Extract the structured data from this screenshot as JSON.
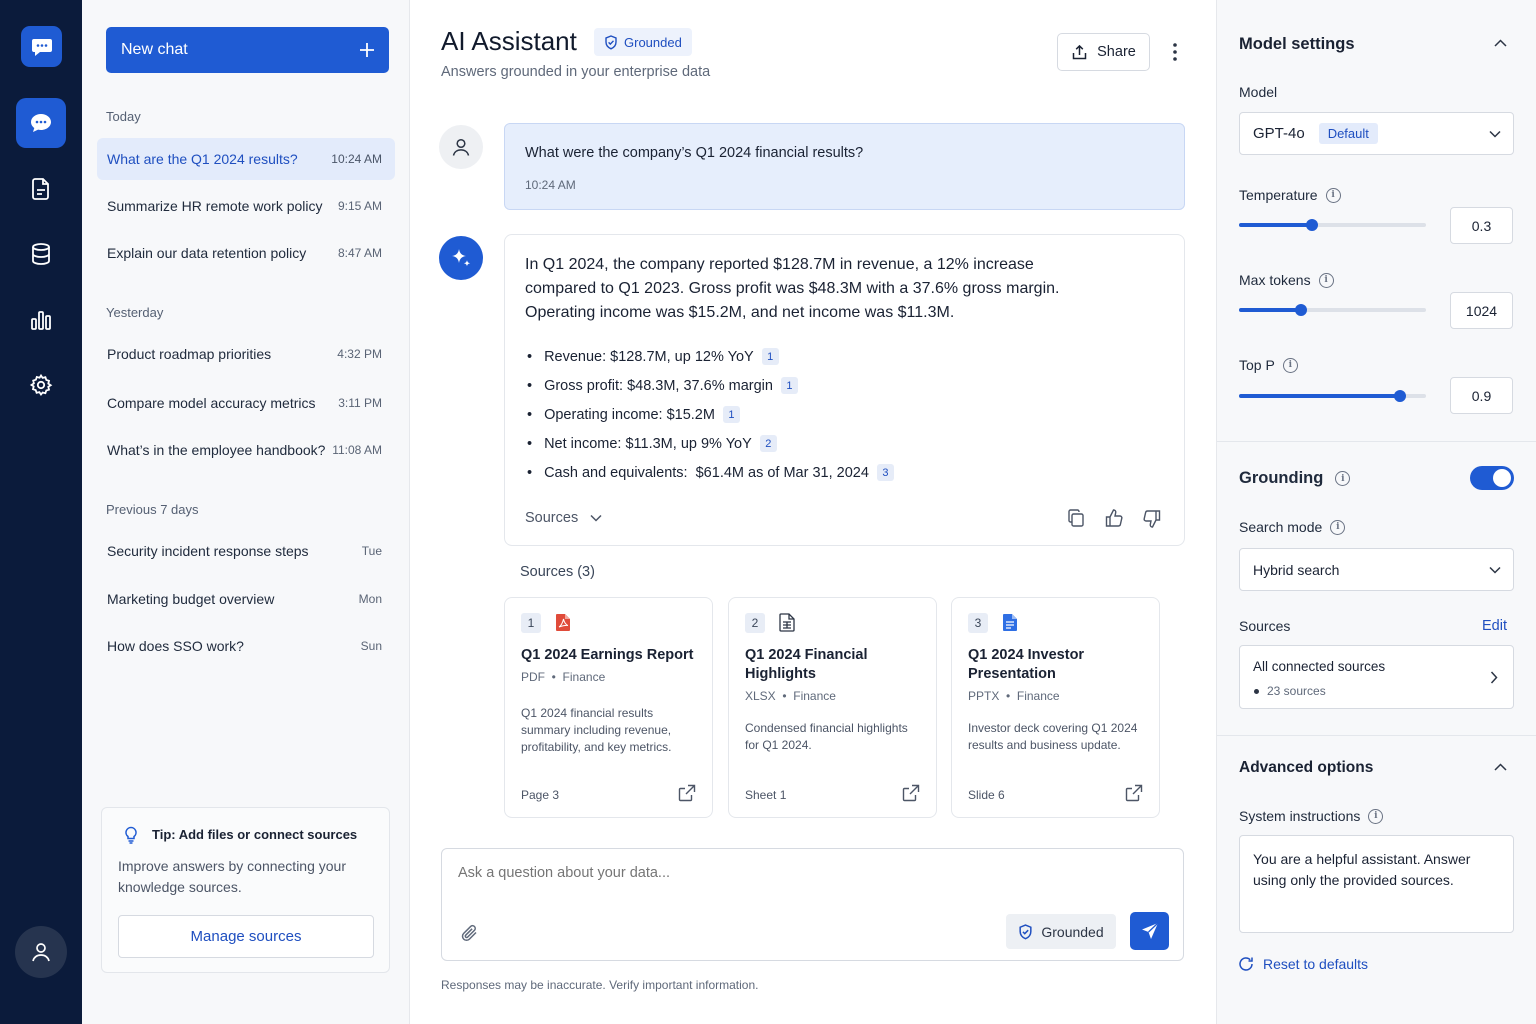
{
  "colors": {
    "accent": "#1f5bd3",
    "rail": "#0b1b3b"
  },
  "rail": {
    "icons": [
      "chat-bubble-icon",
      "chat-icon",
      "document-icon",
      "database-icon",
      "bar-chart-icon",
      "gear-icon",
      "user-icon"
    ]
  },
  "history": {
    "new_chat_label": "New chat",
    "groups": [
      {
        "label": "Today",
        "items": [
          {
            "title": "What are the Q1 2024 results?",
            "time": "10:24 AM"
          },
          {
            "title": "Summarize HR remote work policy",
            "time": "9:15 AM"
          },
          {
            "title": "Explain our data retention policy",
            "time": "8:47 AM"
          }
        ]
      },
      {
        "label": "Yesterday",
        "items": [
          {
            "title": "Product roadmap priorities",
            "time": "4:32 PM"
          },
          {
            "title": "Compare model accuracy metrics",
            "time": "3:11 PM"
          },
          {
            "title": "What’s in the employee handbook?",
            "time": "11:08 AM"
          }
        ]
      },
      {
        "label": "Previous 7 days",
        "items": [
          {
            "title": "Security incident response steps",
            "time": "Tue"
          },
          {
            "title": "Marketing budget overview",
            "time": "Mon"
          },
          {
            "title": "How does SSO work?",
            "time": "Sun"
          }
        ]
      }
    ],
    "tip": {
      "title": "Tip: Add files or connect sources",
      "body": "Improve answers by connecting your knowledge sources.",
      "button": "Manage sources"
    }
  },
  "header": {
    "title": "AI Assistant",
    "badge": "Grounded",
    "subtitle": "Answers grounded in your enterprise data",
    "share_label": "Share"
  },
  "user_message": {
    "text": "What were the company’s Q1 2024 financial results?",
    "time": "10:24 AM"
  },
  "assistant_message": {
    "paragraph": "In Q1 2024, the company reported $128.7M in revenue, a 12% increase compared to Q1 2023. Gross profit was $48.3M with a 37.6% gross margin. Operating income was $15.2M, and net income was $11.3M.",
    "bullets": [
      {
        "text": "Revenue: $128.7M, up 12% YoY",
        "cite": "1"
      },
      {
        "text": "Gross profit: $48.3M, 37.6% margin",
        "cite": "1"
      },
      {
        "text": "Operating income: $15.2M",
        "cite": "1"
      },
      {
        "text": "Net income: $11.3M, up 9% YoY",
        "cite": "2"
      },
      {
        "text": "Cash and equivalents:  $61.4M as of Mar 31, 2024",
        "cite": "3"
      }
    ],
    "sources_toggle": "Sources"
  },
  "sources": {
    "heading": "Sources (3)",
    "cards": [
      {
        "num": "1",
        "icon": "pdf-icon",
        "title": "Q1 2024 Earnings Report",
        "type": "PDF",
        "category": "Finance",
        "desc": "Q1 2024 financial results summary including revenue, profitability, and key metrics.",
        "loc": "Page 3"
      },
      {
        "num": "2",
        "icon": "spreadsheet-icon",
        "title": "Q1 2024 Financial Highlights",
        "type": "XLSX",
        "category": "Finance",
        "desc": "Condensed financial highlights for Q1 2024.",
        "loc": "Sheet 1"
      },
      {
        "num": "3",
        "icon": "presentation-icon",
        "title": "Q1 2024 Investor Presentation",
        "type": "PPTX",
        "category": "Finance",
        "desc": "Investor deck covering Q1 2024 results and business update.",
        "loc": "Slide 6"
      }
    ]
  },
  "composer": {
    "placeholder": "Ask a question about your data...",
    "grounded_label": "Grounded",
    "disclaimer": "Responses may be inaccurate. Verify important information."
  },
  "settings": {
    "title": "Model settings",
    "model_label": "Model",
    "model_value": "GPT-4o",
    "model_badge": "Default",
    "temperature": {
      "label": "Temperature",
      "value": "0.3",
      "level": 0.39
    },
    "max_tokens": {
      "label": "Max tokens",
      "value": "1024",
      "level": 0.33
    },
    "top_p": {
      "label": "Top P",
      "value": "0.9",
      "level": 0.86
    },
    "grounding_label": "Grounding",
    "grounding_on": true,
    "search_mode_label": "Search mode",
    "search_mode_value": "Hybrid search",
    "sources_label": "Sources",
    "sources_edit": "Edit",
    "sources_value": "All connected sources",
    "sources_count": "23 sources",
    "advanced_label": "Advanced options",
    "system_label": "System instructions",
    "system_value": "You are a helpful assistant. Answer using only the provided sources.",
    "reset_label": "Reset to defaults"
  }
}
